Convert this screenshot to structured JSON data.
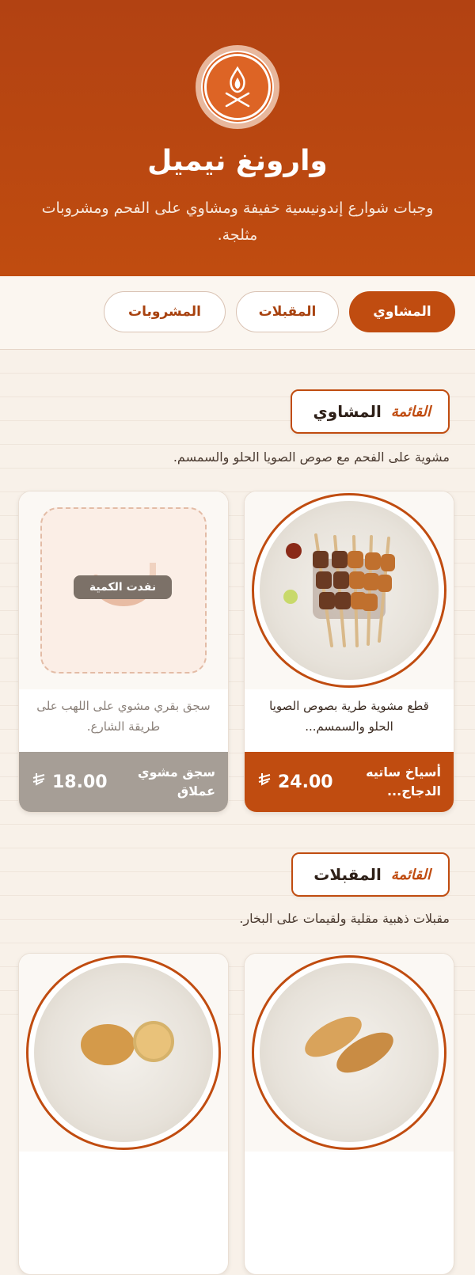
{
  "header": {
    "title": "وارونغ نيميل",
    "subtitle": "وجبات شوارع إندونيسية خفيفة ومشاوي على الفحم ومشروبات مثلجة."
  },
  "tabs": [
    {
      "label": "المشاوي",
      "active": true
    },
    {
      "label": "المقبلات",
      "active": false
    },
    {
      "label": "المشروبات",
      "active": false
    }
  ],
  "sections": [
    {
      "kicker": "القائمة",
      "title": "المشاوي",
      "description": "مشوية على الفحم مع صوص الصويا الحلو والسمسم.",
      "items": [
        {
          "name": "أسياخ ساتيه الدجاج...",
          "description": "قطع مشوية طرية بصوص الصويا الحلو والسمسم...",
          "price": "24.00",
          "sold_out": false
        },
        {
          "name": "سجق مشوي عملاق",
          "description": "سجق بقري مشوي على اللهب على طريقة الشارع.",
          "price": "18.00",
          "sold_out": true,
          "badge": "نفدت الكمية"
        }
      ]
    },
    {
      "kicker": "القائمة",
      "title": "المقبلات",
      "description": "مقبلات ذهبية مقلية ولقيمات على البخار."
    }
  ],
  "icons": {
    "logo": "flame-skewers-icon",
    "currency": "riyal-icon"
  },
  "colors": {
    "brand": "#c04c10",
    "sold_out": "#a69e96",
    "background": "#f8f1e9"
  }
}
